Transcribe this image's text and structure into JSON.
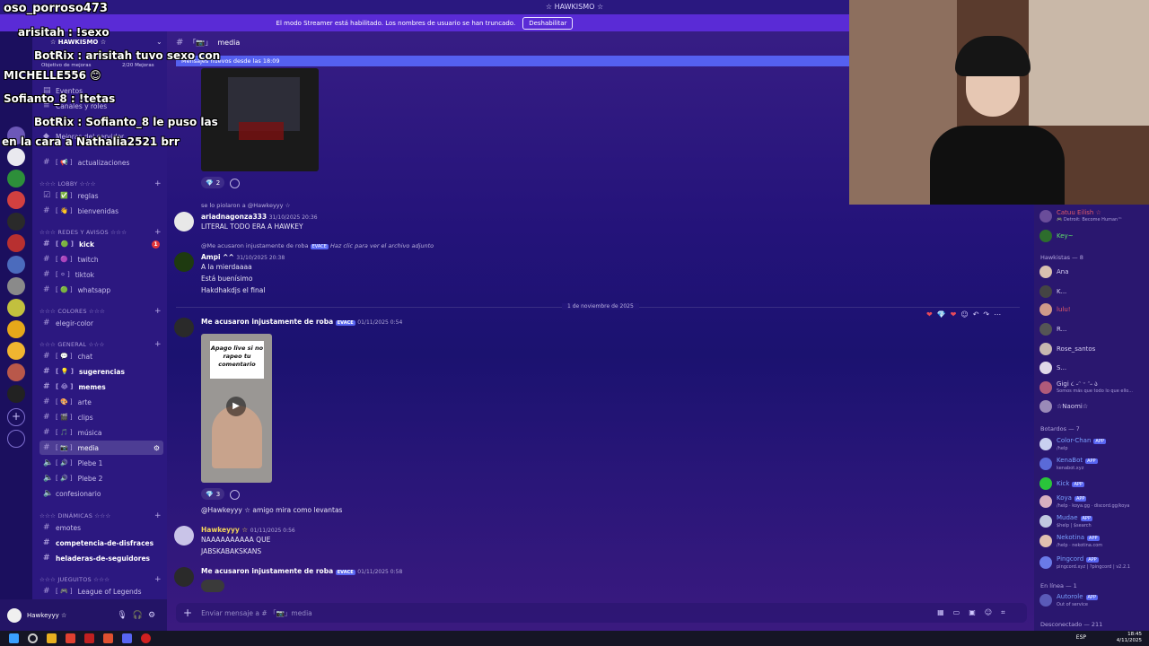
{
  "window": {
    "title": "☆ HAWKISMO ☆"
  },
  "banner": {
    "text": "El modo Streamer está habilitado. Los nombres de usuario se han truncado.",
    "button": "Deshabilitar"
  },
  "overlay": {
    "lines": [
      "oso_porroso473",
      "arisitah : !sexo",
      "BotRix : arisitah tuvo sexo con",
      "MICHELLE556 😊",
      "Sofianto_8 : !tetas",
      "BotRix : Sofianto_8 le puso las",
      "en la cara a Nathalia2521 brr"
    ]
  },
  "sidebar": {
    "server_name": "☆ HAWKISMO ☆",
    "goal": "Objetivo de mejoras",
    "goal_count": "2/20 Mejoras",
    "events": "Eventos",
    "channels_roles": "Canales y roles",
    "server_boosts": "Mejoras del servidor",
    "cat_lobby": "☆☆☆ LOBBY ☆☆☆",
    "cat_redes": "☆☆☆ REDES Y AVISOS ☆☆☆",
    "cat_colores": "☆☆☆ COLORES ☆☆☆",
    "cat_general": "☆☆☆ GENERAL ☆☆☆",
    "cat_dinamicas": "☆☆☆ DINÁMICAS ☆☆☆",
    "cat_juegos": "☆☆☆ JUEGUITOS ☆☆☆",
    "ch": {
      "actualizaciones": "actualizaciones",
      "reglas": "reglas",
      "bienvenidas": "bienvenidas",
      "kick": "kick",
      "twitch": "twitch",
      "tiktok": "tiktok",
      "whatsapp": "whatsapp",
      "elegir_color": "elegir-color",
      "chat": "chat",
      "sugerencias": "sugerencias",
      "memes": "memes",
      "arte": "arte",
      "clips": "clips",
      "musica": "música",
      "media": "media",
      "plebe1": "Plebe 1",
      "plebe2": "Plebe 2",
      "confesionario": "confesionario",
      "emotes": "emotes",
      "competencia": "competencia-de-disfraces",
      "heladeras": "heladeras-de-seguidores",
      "lol": "League of Legends"
    },
    "kick_badge": "1"
  },
  "user": {
    "name": "Hawkeyyy ☆"
  },
  "channel": {
    "name": "media",
    "new_messages": "Mensajes nuevos desde las 18:09"
  },
  "messages": {
    "react1_count": "2",
    "reply1": "se lo piolaron a @Hawkeyyy ☆",
    "m1_author": "ariadnagonza333",
    "m1_meta": "31/10/2025 20:36",
    "m1_text": "LITERAL TODO ERA A HAWKEY",
    "reply2": "@Me acusaron injustamente de roba",
    "reply2_tag": "EVACE",
    "reply2_link": "Haz clic para ver el archivo adjunto",
    "m2_author": "Ampi ^^",
    "m2_meta": "31/10/2025 20:38",
    "m2_t1": "A la mierdaaaa",
    "m2_t2": "Está buenísimo",
    "m2_t3": "Hakdhakdjs el final",
    "date_divider": "1 de noviembre de 2025",
    "m3_author": "Me acusaron injustamente de roba",
    "m3_tag": "EVACE",
    "m3_meta": "01/11/2025 0:54",
    "video_text": "Apago live si no rapeo tu comentario",
    "react2_count": "3",
    "m3_text": "@Hawkeyyy ☆ amigo mira como levantas",
    "m4_author": "Hawkeyyy ☆",
    "m4_meta": "01/11/2025 0:56",
    "m4_t1": "NAAAAAAAAAA QUE",
    "m4_t2": "JABSKABAKSKANS",
    "m5_author": "Me acusaron injustamente de roba",
    "m5_tag": "EVACE",
    "m5_meta": "01/11/2025 0:58"
  },
  "composer": {
    "placeholder": "Enviar mensaje a # 「📷」media"
  },
  "members": {
    "top": [
      {
        "name": "Catuu Eilish ☆",
        "sub": "🎮 Detroit: Become Human™",
        "color": "#e25a6a"
      },
      {
        "name": "Key~",
        "sub": "",
        "color": "#5de06a"
      }
    ],
    "group_hawkistas": "Hawkistas — 8",
    "hawkistas": [
      "Ana",
      "K...",
      "lulu!",
      "R...",
      "Rose_santos",
      "S...",
      "Gigi ૮ ˶ᵔ ᵕ ᵔ˶ ა",
      "☆Naomi☆"
    ],
    "hawk_sub": [
      "",
      "",
      "",
      "",
      "",
      "",
      "Somos más que todo lo que ello...",
      ""
    ],
    "group_bots": "Botardos — 7",
    "bots": [
      "Color-Chan",
      "KenaBot",
      "Kick",
      "Koya",
      "Mudae",
      "Nekotina",
      "Pingcord"
    ],
    "bot_sub": [
      "/help",
      "kenabot.xyz",
      "",
      "/help · koya.gg · discord.gg/koya",
      "$help | $search",
      "/help · nekotina.com",
      "pingcord.xyz | ?pingcord | v2.2.1"
    ],
    "app_tag": "APP",
    "group_online": "En línea — 1",
    "online": "Autorole",
    "online_sub": "Out of service",
    "group_offline": "Desconectado — 211"
  },
  "taskbar": {
    "time": "18:45",
    "date": "4/11/2025",
    "lang": "ESP"
  }
}
